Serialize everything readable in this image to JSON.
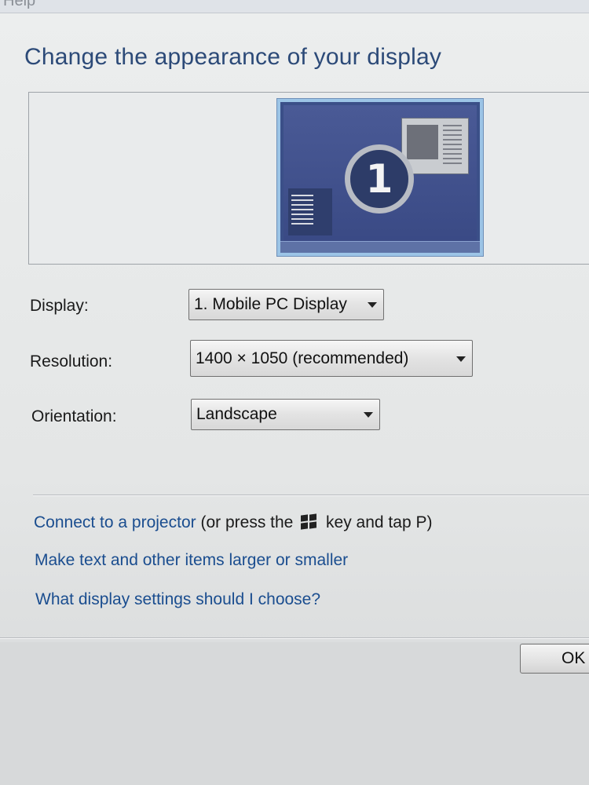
{
  "menu": {
    "partial_item": "Help"
  },
  "title": "Change the appearance of your display",
  "preview": {
    "monitor_number": "1"
  },
  "fields": {
    "display": {
      "label": "Display:",
      "value": "1. Mobile PC Display"
    },
    "resolution": {
      "label": "Resolution:",
      "value": "1400 × 1050 (recommended)"
    },
    "orientation": {
      "label": "Orientation:",
      "value": "Landscape"
    }
  },
  "links": {
    "projector": {
      "link_text": "Connect to a projector",
      "suffix_before": "(or press the",
      "suffix_after": "key and tap P)"
    },
    "text_size": "Make text and other items larger or smaller",
    "help": "What display settings should I choose?"
  },
  "buttons": {
    "ok": "OK"
  },
  "icons": {
    "windows_key": "windows-logo-icon",
    "dropdown": "chevron-down-icon"
  }
}
